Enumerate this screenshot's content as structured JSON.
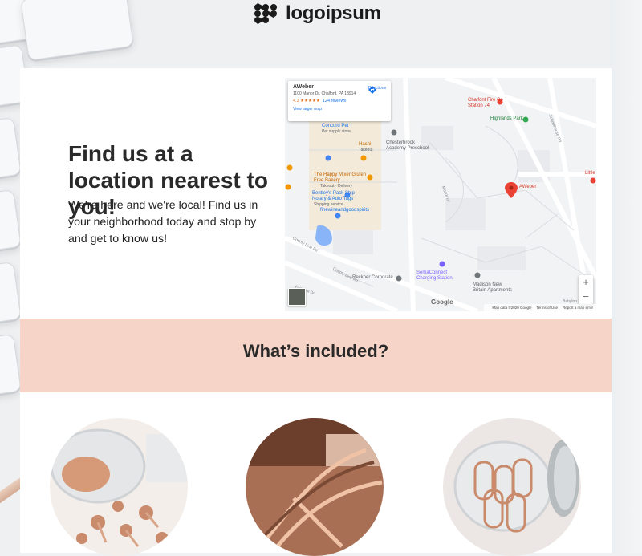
{
  "header": {
    "logo_text": "logoipsum",
    "logo_mark": "logo-mark-icon"
  },
  "intro": {
    "title": "Find us at a location nearest to you!",
    "body": "We're here and we're local! Find us in your neighborhood today and stop by and get to know us!"
  },
  "map": {
    "place_name": "AWeber",
    "address": "1100 Manor Dr, Chalfont, PA 18914",
    "rating": "4.3 ★★★★★",
    "reviews": "124 reviews",
    "directions": "Directions",
    "view_larger": "View larger map",
    "zoom_in": "+",
    "zoom_out": "−",
    "google": "Google",
    "footer_data": "Map data ©2020 Google",
    "footer_terms": "Terms of Use",
    "footer_report": "Report a map error",
    "pin_label": "AWeber",
    "labels": {
      "chalfont_fire": "Chalfont Fire Co Station 74",
      "highlands_park": "Highlands Park",
      "concord_pet": "Concord Pet",
      "concord_pet_sub": "Pet supply store",
      "chesterbrook": "Chesterbrook Academy Preschool",
      "hachi": "Hachi",
      "hachi_sub": "Takeout",
      "happy_mixer": "The Happy Mixer Gluten Free Bakery",
      "happy_mixer_sub": "Takeout · Delivery",
      "bentleys": "Bentley's Pack Ship Notary & Auto Tags",
      "bentleys_sub": "Shipping service",
      "finewine": "finewineandgoodspirits",
      "reckner": "Reckner Corporate",
      "semaconnect": "SemaConnect Charging Station",
      "madison": "Madison New Britain Apartments",
      "little": "Little",
      "county_line": "County Line Rd",
      "county_line2": "County Line Rd",
      "manor_dr": "Manor Dr",
      "schoolhouse": "Schoolhouse Rd",
      "fairview": "Fairview Dr",
      "babylon": "Babylon Bl"
    }
  },
  "included": {
    "title": "What’s included?"
  },
  "colors": {
    "band_bg": "#f6d5c8",
    "copper": "#c98b6b",
    "pin_red": "#ea4335"
  }
}
